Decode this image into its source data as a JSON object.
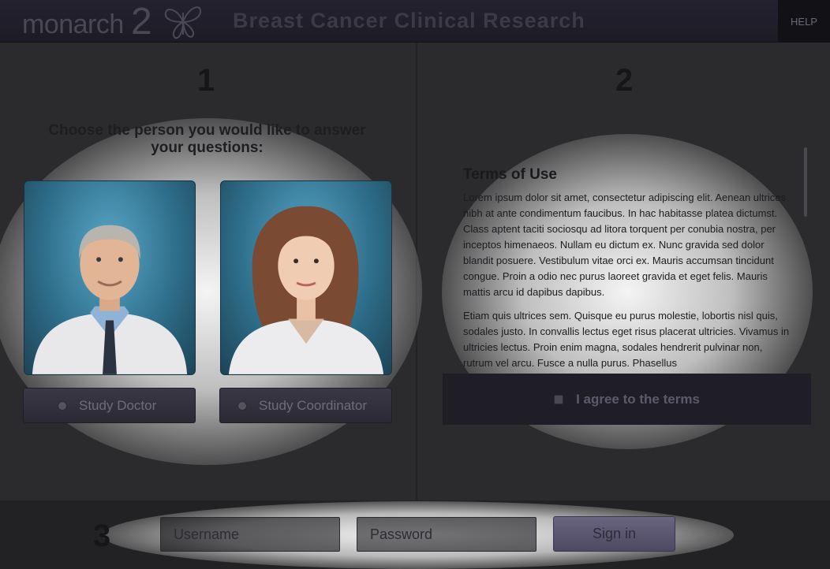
{
  "header": {
    "logo_text": "monarch",
    "logo_number": "2",
    "title": "Breast Cancer Clinical Research",
    "help_label": "HELP"
  },
  "step1": {
    "number": "1",
    "prompt": "Choose the person you would like to answer your questions:",
    "options": [
      {
        "label": "Study Doctor",
        "selected": false
      },
      {
        "label": "Study Coordinator",
        "selected": false
      }
    ]
  },
  "step2": {
    "number": "2",
    "terms_title": "Terms of Use",
    "terms_paragraphs": [
      "Lorem ipsum dolor sit amet, consectetur adipiscing elit. Aenean ultrices nibh at ante condimentum faucibus. In hac habitasse platea dictumst. Class aptent taciti sociosqu ad litora torquent per conubia nostra, per inceptos himenaeos. Nullam eu dictum ex. Nunc gravida sed dolor blandit posuere. Vestibulum vitae orci ex. Mauris accumsan tincidunt congue. Proin a odio nec purus laoreet gravida et eget felis. Mauris mattis arcu id dapibus dapibus.",
      "Etiam quis ultrices sem. Quisque eu purus molestie, lobortis nisl quis, sodales justo. In convallis lectus eget risus placerat ultricies. Vivamus in ultricies lectus. Proin enim magna, sodales hendrerit pulvinar non, rutrum vel arcu. Fusce a nulla purus. Phasellus"
    ],
    "agree_label": "I agree to the terms",
    "agree_checked": false
  },
  "step3": {
    "number": "3",
    "username_placeholder": "Username",
    "password_placeholder": "Password",
    "signin_label": "Sign in"
  },
  "colors": {
    "header_bg": "#1f1e28",
    "panel_bg": "#2b2b2d",
    "button_bg": "#332f3f",
    "signin_bg": "#5a5570"
  }
}
